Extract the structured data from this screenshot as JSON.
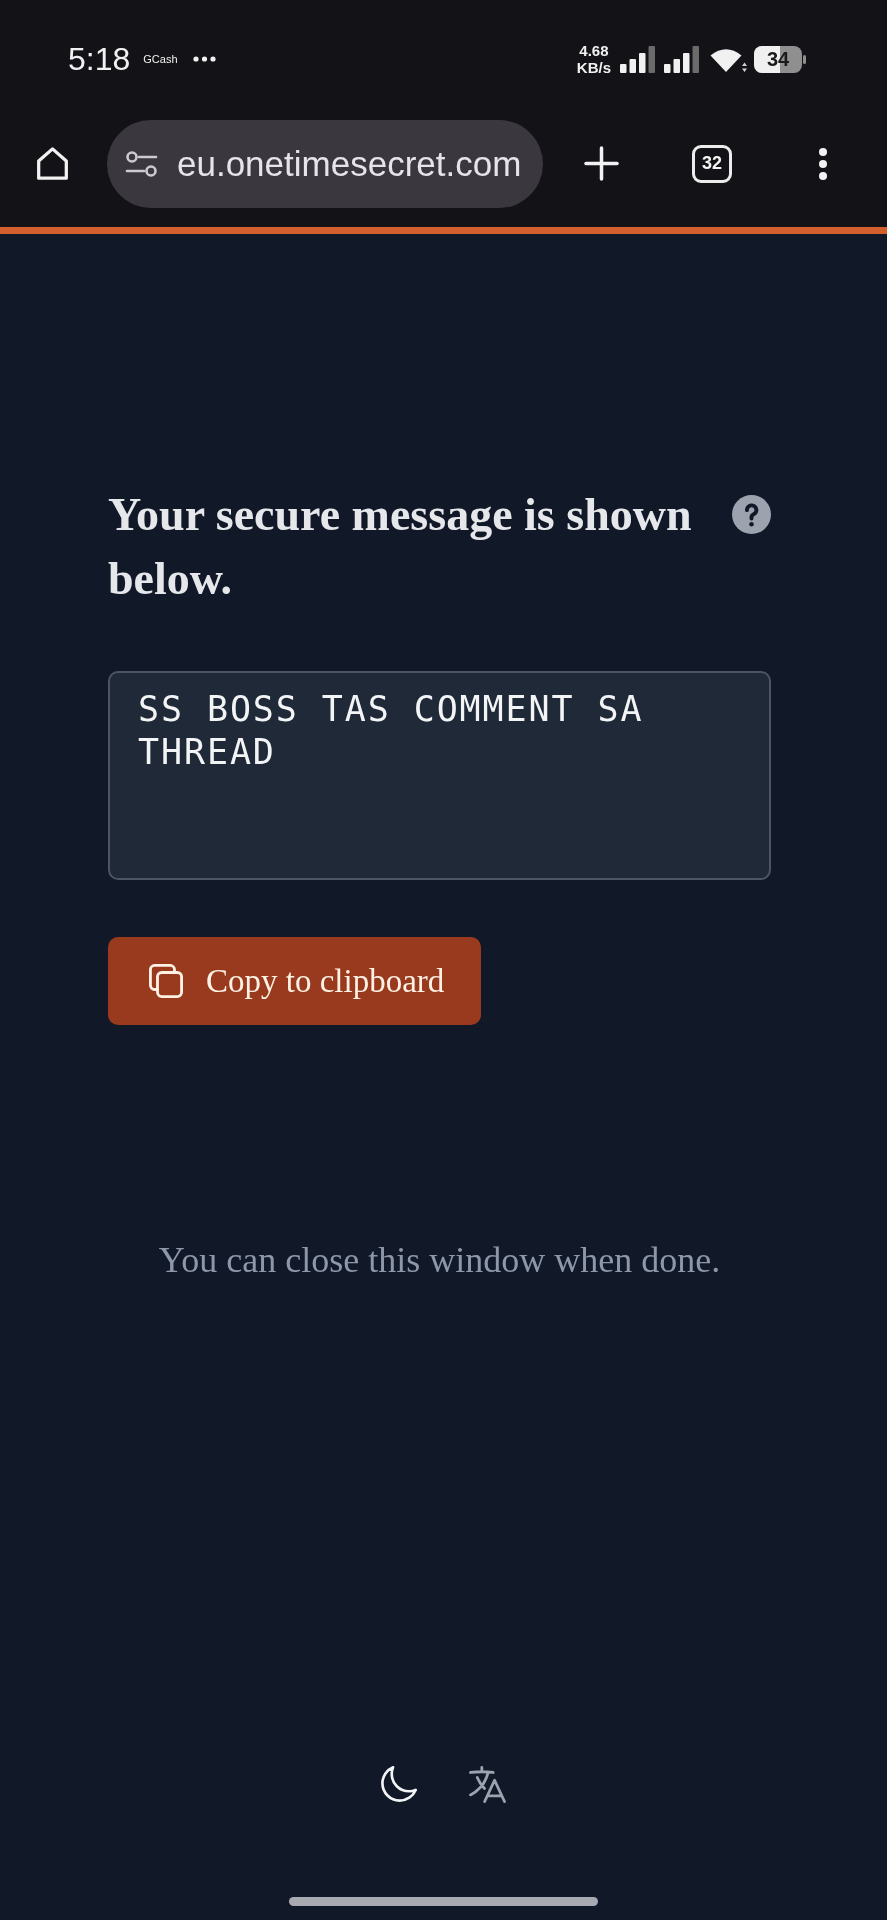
{
  "status_bar": {
    "time": "5:18",
    "notification_label": "GCash",
    "network_speed": "4.68",
    "network_unit": "KB/s",
    "battery": "34"
  },
  "browser_bar": {
    "url": "eu.onetimesecret.com",
    "tab_count": "32"
  },
  "secret": {
    "heading": "Your secure message is shown below.",
    "message": "SS BOSS TAS COMMENT SA THREAD",
    "copy_button": "Copy to clipboard"
  },
  "footer": {
    "note": "You can close this window when done."
  }
}
